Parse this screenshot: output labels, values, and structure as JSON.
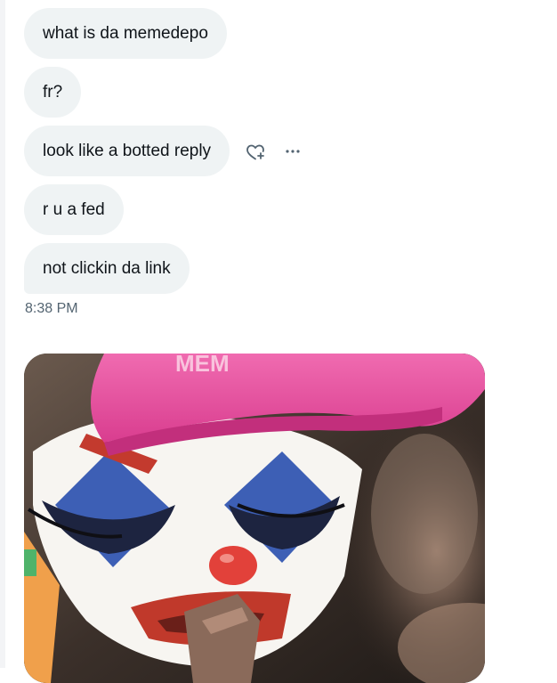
{
  "messages": [
    {
      "text": "what is da memedepo"
    },
    {
      "text": "fr?"
    },
    {
      "text": "look like a botted reply"
    },
    {
      "text": "r u a fed"
    },
    {
      "text": "not clickin da link"
    }
  ],
  "message_actions": {
    "react_icon": "heart-plus-icon",
    "more_icon": "more-horizontal-icon"
  },
  "timestamp": "8:38 PM",
  "media": {
    "cap_text": "MEM"
  },
  "colors": {
    "bubble_bg": "#eff3f4",
    "text": "#0f1419",
    "secondary_text": "#536471",
    "cap_pink": "#e8449c",
    "icon": "#536471"
  }
}
